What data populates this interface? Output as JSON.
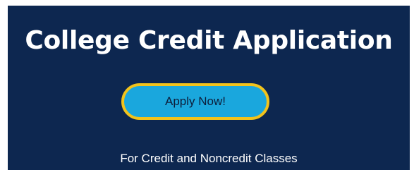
{
  "header": {
    "title": "College Credit Application"
  },
  "cta": {
    "label": "Apply Now!"
  },
  "footer": {
    "subtitle": "For Credit and Noncredit Classes"
  },
  "colors": {
    "background": "#0d2750",
    "button_fill": "#1aa7dd",
    "button_border": "#f2c31b",
    "text": "#ffffff"
  }
}
